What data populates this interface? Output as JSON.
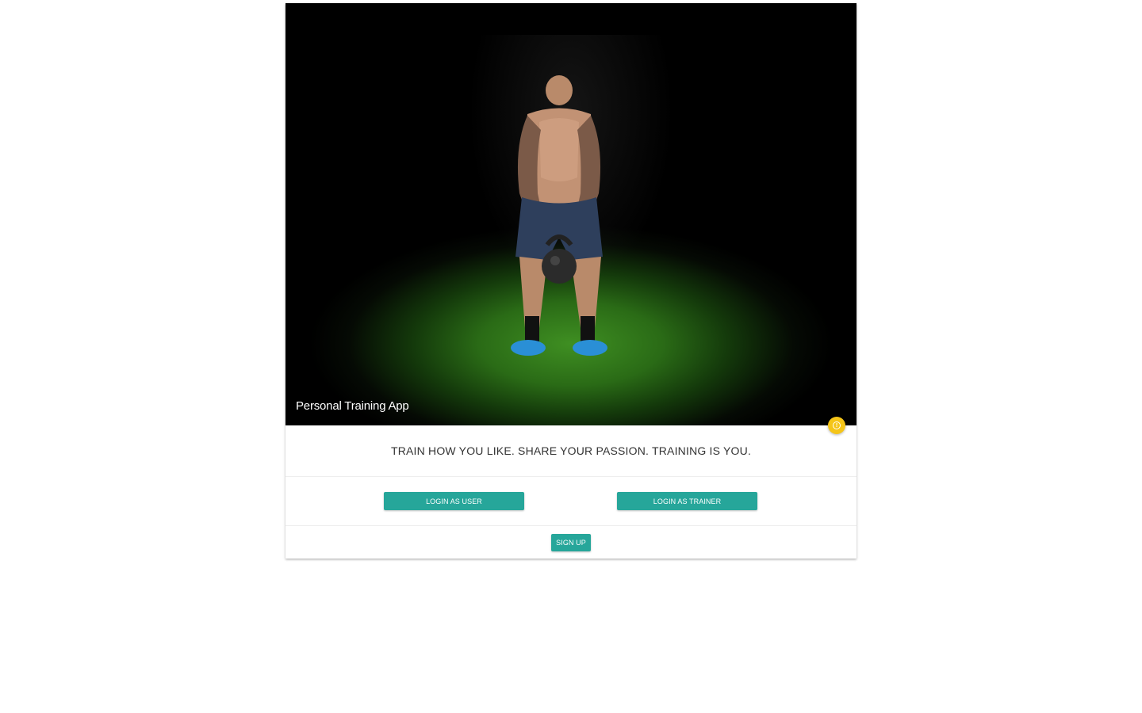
{
  "hero": {
    "title": "Personal Training App",
    "image": "man-lifting-kettlebell-on-turf"
  },
  "tagline": "TRAIN HOW YOU LIKE. SHARE YOUR PASSION. TRAINING IS YOU.",
  "actions": {
    "login_user": "LOGIN AS USER",
    "login_trainer": "LOGIN AS TRAINER",
    "signup": "SIGN UP"
  },
  "fab": {
    "icon": "info-icon",
    "color": "#f5c518"
  },
  "colors": {
    "accent": "#26a69a"
  }
}
